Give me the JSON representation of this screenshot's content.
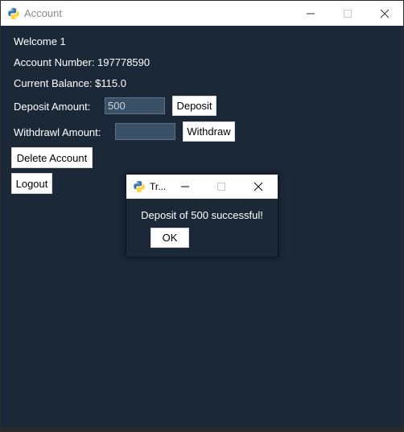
{
  "window": {
    "title": "Account",
    "icon": "python-icon"
  },
  "account": {
    "welcome": "Welcome 1",
    "account_number": "Account Number: 197778590",
    "current_balance": "Current Balance: $115.0",
    "deposit_label": "Deposit Amount:",
    "deposit_value": "500",
    "deposit_button": "Deposit",
    "withdraw_label": "Withdrawl Amount:",
    "withdraw_value": "",
    "withdraw_button": "Withdraw",
    "delete_button": "Delete Account",
    "logout_button": "Logout"
  },
  "dialog": {
    "title": "Tr...",
    "message": "Deposit of 500 successful!",
    "ok_button": "OK"
  },
  "colors": {
    "background": "#1b2838",
    "entry": "#3a5066",
    "text": "#ffffff"
  }
}
